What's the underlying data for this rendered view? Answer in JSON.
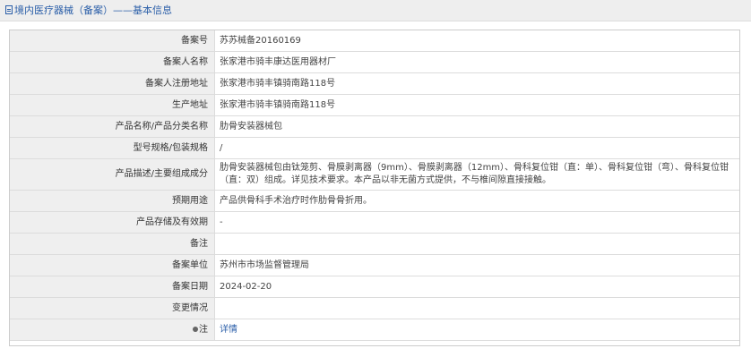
{
  "header": {
    "title": "境内医疗器械（备案）——基本信息"
  },
  "rows": [
    {
      "label": "备案号",
      "value": "苏苏械备20160169"
    },
    {
      "label": "备案人名称",
      "value": "张家港市骑丰康达医用器材厂"
    },
    {
      "label": "备案人注册地址",
      "value": "张家港市骑丰镇骑南路118号"
    },
    {
      "label": "生产地址",
      "value": "张家港市骑丰镇骑南路118号"
    },
    {
      "label": "产品名称/产品分类名称",
      "value": "肋骨安装器械包"
    },
    {
      "label": "型号规格/包装规格",
      "value": "/"
    },
    {
      "label": "产品描述/主要组成成分",
      "value": "肋骨安装器械包由钛笼剪、骨膜剥离器（9mm）、骨膜剥离器（12mm）、骨科复位钳（直：单）、骨科复位钳（弯）、骨科复位钳（直：双）组成。详见技术要求。本产品以非无菌方式提供，不与椎间隙直接接触。"
    },
    {
      "label": "预期用途",
      "value": "产品供骨科手术治疗时作肋骨骨折用。"
    },
    {
      "label": "产品存储及有效期",
      "value": "-"
    },
    {
      "label": "备注",
      "value": ""
    },
    {
      "label": "备案单位",
      "value": "苏州市市场监督管理局"
    },
    {
      "label": "备案日期",
      "value": "2024-02-20"
    },
    {
      "label": "变更情况",
      "value": ""
    },
    {
      "label": "注",
      "value": "详情"
    }
  ],
  "icons": {
    "header": "document-icon",
    "note": "pin-icon"
  },
  "colors": {
    "link": "#2a5ea8",
    "label_bg": "#efefef",
    "header_bg": "#eeeeee"
  }
}
